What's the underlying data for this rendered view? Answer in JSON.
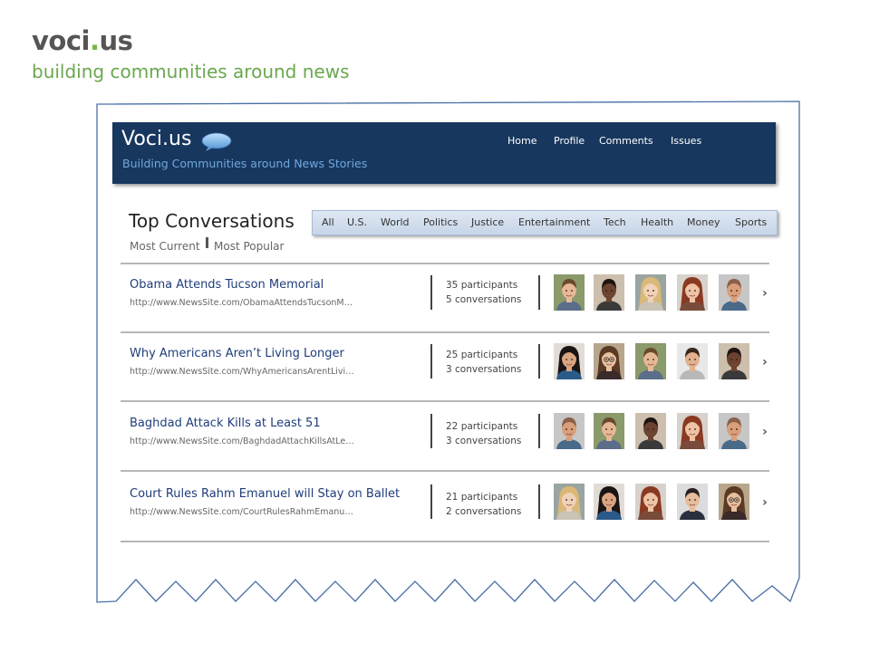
{
  "slide": {
    "title_part1": "voci",
    "title_dot": ".",
    "title_part2": "us",
    "subtitle": "building communities around news"
  },
  "app": {
    "title": "Voci.us",
    "tagline": "Building Communities around News Stories",
    "nav": [
      "Home",
      "Profile",
      "Comments",
      "Issues"
    ]
  },
  "section": {
    "title": "Top Conversations",
    "sort": [
      "Most Current",
      "Most Popular"
    ]
  },
  "categories": [
    "All",
    "U.S.",
    "World",
    "Politics",
    "Justice",
    "Entertainment",
    "Tech",
    "Health",
    "Money",
    "Sports"
  ],
  "stories": [
    {
      "title": "Obama Attends Tucson Memorial",
      "url": "http://www.NewsSite.com/ObamaAttendsTucsonM…",
      "participants": "35 participants",
      "conversations": "5 conversations",
      "avatars": [
        "young-man",
        "dark-man",
        "blonde-woman",
        "red-hair-woman",
        "bald-man"
      ]
    },
    {
      "title": "Why Americans Aren’t Living Longer",
      "url": "http://www.NewsSite.com/WhyAmericansArentLivi…",
      "participants": "25 participants",
      "conversations": "3 conversations",
      "avatars": [
        "dark-hair-woman",
        "glasses-woman",
        "young-man",
        "smiling-man",
        "dark-man"
      ]
    },
    {
      "title": "Baghdad Attack Kills at Least 51",
      "url": "http://www.NewsSite.com/BaghdadAttachKillsAtLe…",
      "participants": "22 participants",
      "conversations": "3 conversations",
      "avatars": [
        "bald-man",
        "young-man",
        "dark-man",
        "red-hair-woman",
        "bald-man"
      ]
    },
    {
      "title": "Court Rules Rahm Emanuel will Stay on Ballet",
      "url": "http://www.NewsSite.com/CourtRulesRahmEmanu…",
      "participants": "21 participants",
      "conversations": "2 conversations",
      "avatars": [
        "blonde-woman",
        "dark-hair-woman",
        "red-hair-woman",
        "suit-man",
        "glasses-woman"
      ]
    }
  ],
  "colors": {
    "header_bg": "#17375e",
    "tagline": "#6fa8dc",
    "slide_green": "#6aa84f",
    "link": "#1f3d7a",
    "frame": "#4a6fa5"
  }
}
